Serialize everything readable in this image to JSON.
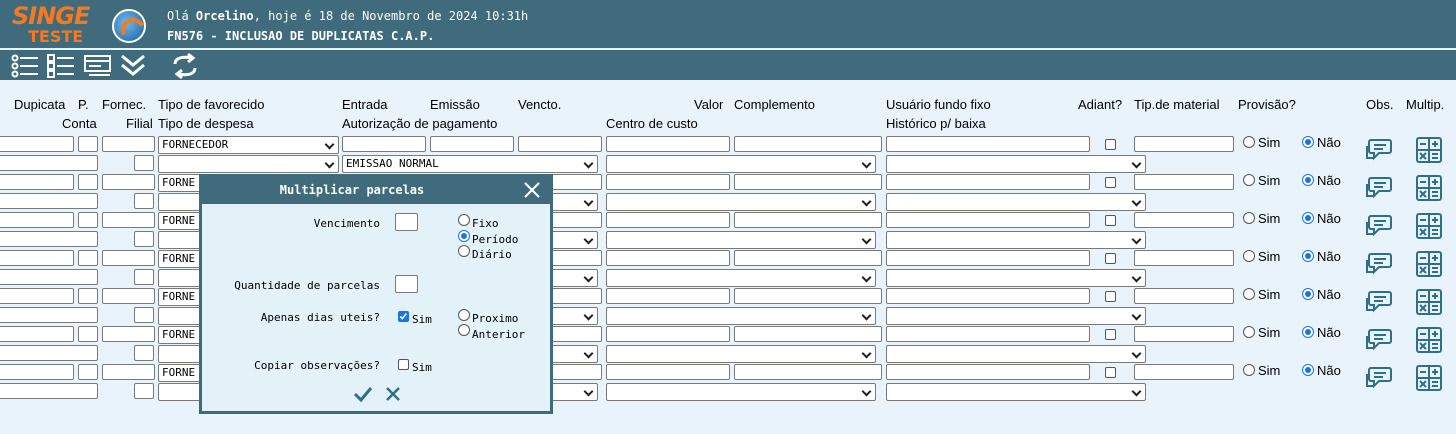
{
  "header": {
    "logo_title": "SINGE",
    "logo_sub": "TESTE",
    "greeting_prefix": "Olá ",
    "user_name": "Orcelino",
    "greeting_suffix": ", hoje é 18 de Novembro de 2024 10:31h",
    "program": "FN576 - INCLUSAO DE DUPLICATAS C.A.P."
  },
  "toolbar": {
    "icons": [
      "list-icon",
      "checklist-icon",
      "card-icon",
      "double-chevron-down-icon",
      "refresh-icon"
    ]
  },
  "columns": {
    "row1": {
      "duplicata": "Dupicata",
      "p": "P.",
      "fornec": "Fornec.",
      "tipo_favorecido": "Tipo de favorecido",
      "entrada": "Entrada",
      "emissao": "Emissão",
      "vencto": "Vencto.",
      "valor": "Valor",
      "complemento": "Complemento",
      "usuario_fundo_fixo": "Usuário fundo fixo",
      "adiant": "Adiant?",
      "tip_material": "Tip.de material",
      "provisao": "Provisão?",
      "obs": "Obs.",
      "multip": "Multip."
    },
    "row2": {
      "conta": "Conta",
      "filial": "Filial",
      "tipo_despesa": "Tipo de despesa",
      "autorizacao": "Autorização de pagamento",
      "centro_custo": "Centro de custo",
      "historico": "Histórico p/ baixa"
    }
  },
  "rows": [
    {
      "tipo_favorecido": "FORNECEDOR",
      "autorizacao": "EMISSAO NORMAL",
      "provisao_sim": "Sim",
      "provisao_nao": "Não"
    },
    {
      "tipo_favorecido": "FORNE",
      "autorizacao": "",
      "provisao_sim": "Sim",
      "provisao_nao": "Não"
    },
    {
      "tipo_favorecido": "FORNE",
      "autorizacao": "",
      "provisao_sim": "Sim",
      "provisao_nao": "Não"
    },
    {
      "tipo_favorecido": "FORNE",
      "autorizacao": "",
      "provisao_sim": "Sim",
      "provisao_nao": "Não"
    },
    {
      "tipo_favorecido": "FORNE",
      "autorizacao": "",
      "provisao_sim": "Sim",
      "provisao_nao": "Não"
    },
    {
      "tipo_favorecido": "FORNE",
      "autorizacao": "",
      "provisao_sim": "Sim",
      "provisao_nao": "Não"
    },
    {
      "tipo_favorecido": "FORNE",
      "autorizacao": "",
      "provisao_sim": "Sim",
      "provisao_nao": "Não"
    }
  ],
  "modal": {
    "title": "Multiplicar parcelas",
    "vencimento_label": "Vencimento",
    "opt_fixo": "Fixo",
    "opt_periodo": "Período",
    "opt_diario": "Diário",
    "quantidade_label": "Quantidade de parcelas",
    "dias_uteis_label": "Apenas dias uteis?",
    "dias_uteis_sim": "Sim",
    "opt_proximo": "Proximo",
    "opt_anterior": "Anterior",
    "copiar_obs_label": "Copiar observações?",
    "copiar_obs_sim": "Sim"
  },
  "colors": {
    "header_bg": "#3f6b7c",
    "page_bg": "#e8f3fb",
    "logo": "#f47a20",
    "accent": "#1a73e8"
  }
}
